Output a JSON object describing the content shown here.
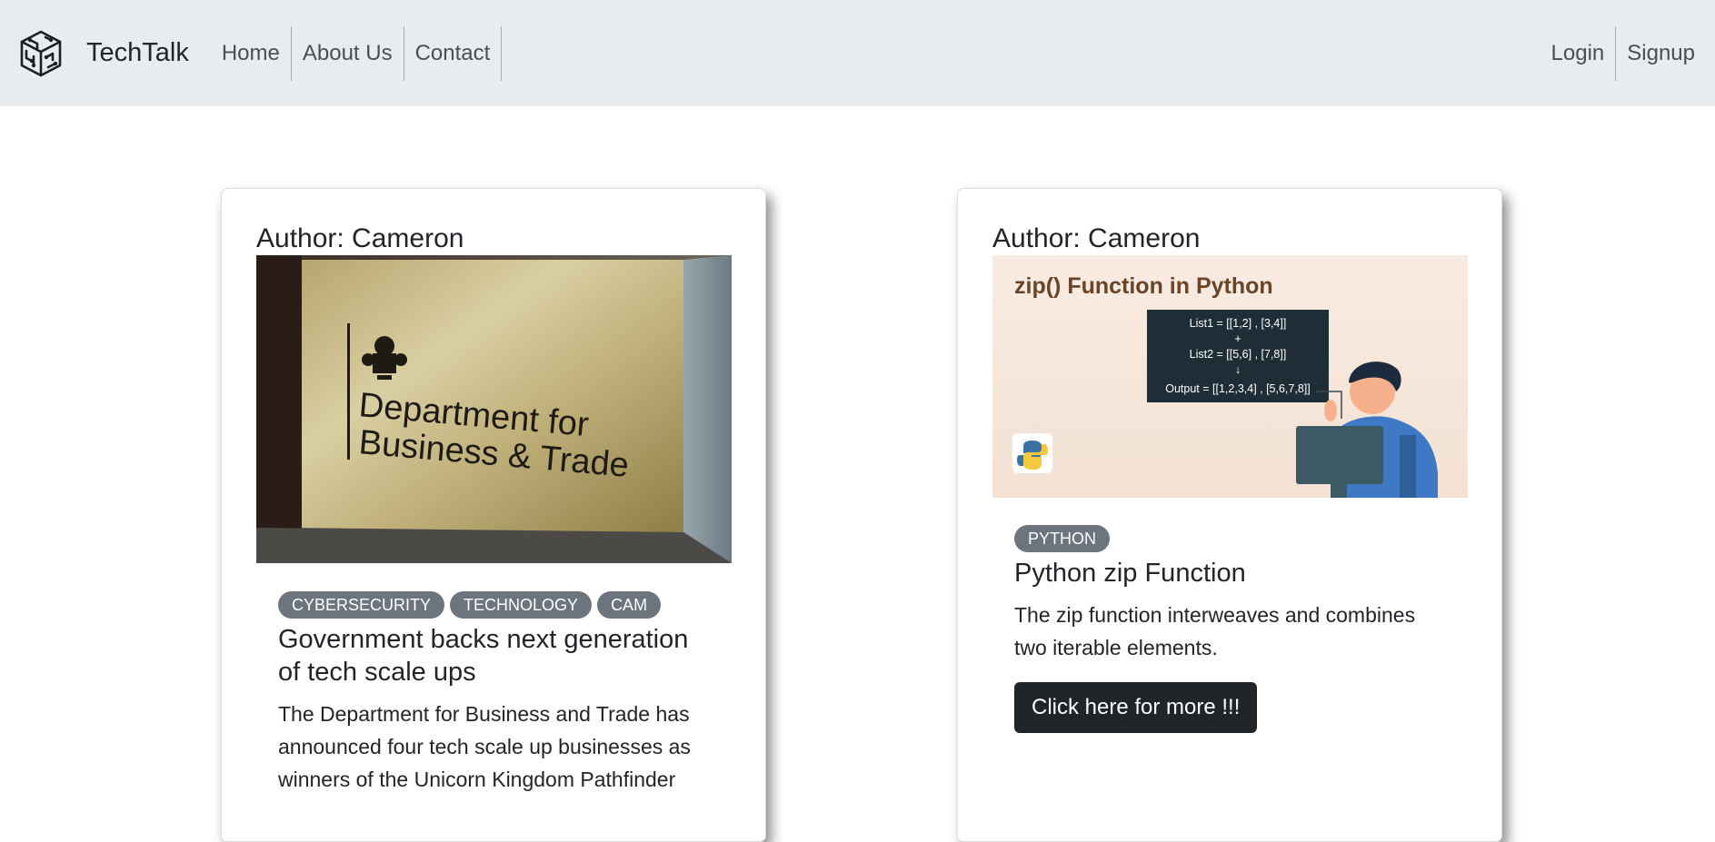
{
  "brand": {
    "name": "TechTalk",
    "logo_icon": "circuit-cube-icon"
  },
  "nav": {
    "left": [
      "Home",
      "About Us",
      "Contact"
    ],
    "right": [
      "Login",
      "Signup"
    ]
  },
  "posts": [
    {
      "author": "Author: Cameron",
      "image": {
        "caption": [
          "Department for",
          "Business & Trade"
        ]
      },
      "tags": [
        "CYBERSECURITY",
        "TECHNOLOGY",
        "CAM"
      ],
      "title": "Government backs next generation of tech scale ups",
      "excerpt": "The Department for Business and Trade has announced four tech scale up businesses as winners of the Unicorn Kingdom Pathfinder"
    },
    {
      "author": "Author: Cameron",
      "image": {
        "heading": "zip() Function in Python",
        "code": [
          "List1 = [[1,2] , [3,4]]",
          "+",
          "List2 = [[5,6] , [7,8]]",
          "↓",
          "Output = [[1,2,3,4] , [5,6,7,8]]"
        ]
      },
      "tags": [
        "PYTHON"
      ],
      "title": "Python zip Function",
      "excerpt": "The zip function interweaves and combines two iterable elements.",
      "button": "Click here for more !!!"
    }
  ],
  "colors": {
    "navbar_bg": "#e9ecef",
    "badge_bg": "#6c757d",
    "button_bg": "#212529"
  }
}
